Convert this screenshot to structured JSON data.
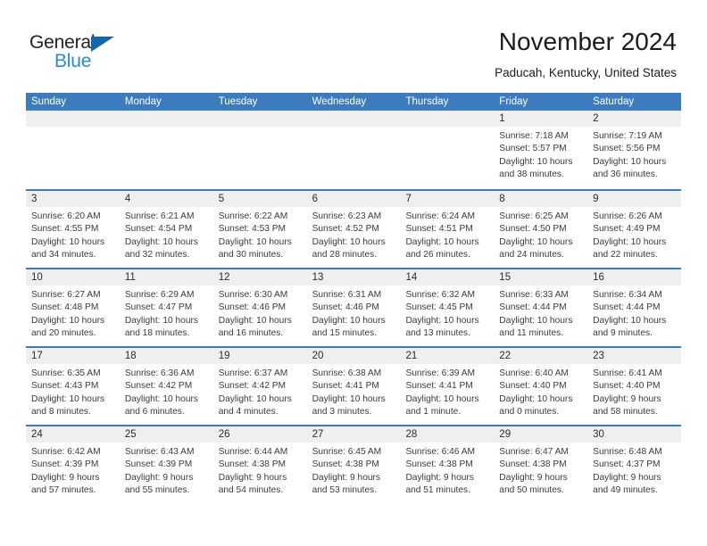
{
  "brand": {
    "name_part1": "General",
    "name_part2": "Blue",
    "triangle_color": "#1266ad",
    "blue_color": "#2a8ad4"
  },
  "header": {
    "title": "November 2024",
    "subtitle": "Paducah, Kentucky, United States",
    "accent_color": "#3c7cbe",
    "band_color": "#efefef"
  },
  "weekdays": [
    "Sunday",
    "Monday",
    "Tuesday",
    "Wednesday",
    "Thursday",
    "Friday",
    "Saturday"
  ],
  "labels": {
    "sunrise": "Sunrise:",
    "sunset": "Sunset:",
    "daylight": "Daylight:"
  },
  "weeks": [
    [
      {
        "day": "",
        "empty": true
      },
      {
        "day": "",
        "empty": true
      },
      {
        "day": "",
        "empty": true
      },
      {
        "day": "",
        "empty": true
      },
      {
        "day": "",
        "empty": true
      },
      {
        "day": "1",
        "sunrise": "Sunrise: 7:18 AM",
        "sunset": "Sunset: 5:57 PM",
        "daylight_line1": "Daylight: 10 hours",
        "daylight_line2": "and 38 minutes."
      },
      {
        "day": "2",
        "sunrise": "Sunrise: 7:19 AM",
        "sunset": "Sunset: 5:56 PM",
        "daylight_line1": "Daylight: 10 hours",
        "daylight_line2": "and 36 minutes."
      }
    ],
    [
      {
        "day": "3",
        "sunrise": "Sunrise: 6:20 AM",
        "sunset": "Sunset: 4:55 PM",
        "daylight_line1": "Daylight: 10 hours",
        "daylight_line2": "and 34 minutes."
      },
      {
        "day": "4",
        "sunrise": "Sunrise: 6:21 AM",
        "sunset": "Sunset: 4:54 PM",
        "daylight_line1": "Daylight: 10 hours",
        "daylight_line2": "and 32 minutes."
      },
      {
        "day": "5",
        "sunrise": "Sunrise: 6:22 AM",
        "sunset": "Sunset: 4:53 PM",
        "daylight_line1": "Daylight: 10 hours",
        "daylight_line2": "and 30 minutes."
      },
      {
        "day": "6",
        "sunrise": "Sunrise: 6:23 AM",
        "sunset": "Sunset: 4:52 PM",
        "daylight_line1": "Daylight: 10 hours",
        "daylight_line2": "and 28 minutes."
      },
      {
        "day": "7",
        "sunrise": "Sunrise: 6:24 AM",
        "sunset": "Sunset: 4:51 PM",
        "daylight_line1": "Daylight: 10 hours",
        "daylight_line2": "and 26 minutes."
      },
      {
        "day": "8",
        "sunrise": "Sunrise: 6:25 AM",
        "sunset": "Sunset: 4:50 PM",
        "daylight_line1": "Daylight: 10 hours",
        "daylight_line2": "and 24 minutes."
      },
      {
        "day": "9",
        "sunrise": "Sunrise: 6:26 AM",
        "sunset": "Sunset: 4:49 PM",
        "daylight_line1": "Daylight: 10 hours",
        "daylight_line2": "and 22 minutes."
      }
    ],
    [
      {
        "day": "10",
        "sunrise": "Sunrise: 6:27 AM",
        "sunset": "Sunset: 4:48 PM",
        "daylight_line1": "Daylight: 10 hours",
        "daylight_line2": "and 20 minutes."
      },
      {
        "day": "11",
        "sunrise": "Sunrise: 6:29 AM",
        "sunset": "Sunset: 4:47 PM",
        "daylight_line1": "Daylight: 10 hours",
        "daylight_line2": "and 18 minutes."
      },
      {
        "day": "12",
        "sunrise": "Sunrise: 6:30 AM",
        "sunset": "Sunset: 4:46 PM",
        "daylight_line1": "Daylight: 10 hours",
        "daylight_line2": "and 16 minutes."
      },
      {
        "day": "13",
        "sunrise": "Sunrise: 6:31 AM",
        "sunset": "Sunset: 4:46 PM",
        "daylight_line1": "Daylight: 10 hours",
        "daylight_line2": "and 15 minutes."
      },
      {
        "day": "14",
        "sunrise": "Sunrise: 6:32 AM",
        "sunset": "Sunset: 4:45 PM",
        "daylight_line1": "Daylight: 10 hours",
        "daylight_line2": "and 13 minutes."
      },
      {
        "day": "15",
        "sunrise": "Sunrise: 6:33 AM",
        "sunset": "Sunset: 4:44 PM",
        "daylight_line1": "Daylight: 10 hours",
        "daylight_line2": "and 11 minutes."
      },
      {
        "day": "16",
        "sunrise": "Sunrise: 6:34 AM",
        "sunset": "Sunset: 4:44 PM",
        "daylight_line1": "Daylight: 10 hours",
        "daylight_line2": "and 9 minutes."
      }
    ],
    [
      {
        "day": "17",
        "sunrise": "Sunrise: 6:35 AM",
        "sunset": "Sunset: 4:43 PM",
        "daylight_line1": "Daylight: 10 hours",
        "daylight_line2": "and 8 minutes."
      },
      {
        "day": "18",
        "sunrise": "Sunrise: 6:36 AM",
        "sunset": "Sunset: 4:42 PM",
        "daylight_line1": "Daylight: 10 hours",
        "daylight_line2": "and 6 minutes."
      },
      {
        "day": "19",
        "sunrise": "Sunrise: 6:37 AM",
        "sunset": "Sunset: 4:42 PM",
        "daylight_line1": "Daylight: 10 hours",
        "daylight_line2": "and 4 minutes."
      },
      {
        "day": "20",
        "sunrise": "Sunrise: 6:38 AM",
        "sunset": "Sunset: 4:41 PM",
        "daylight_line1": "Daylight: 10 hours",
        "daylight_line2": "and 3 minutes."
      },
      {
        "day": "21",
        "sunrise": "Sunrise: 6:39 AM",
        "sunset": "Sunset: 4:41 PM",
        "daylight_line1": "Daylight: 10 hours",
        "daylight_line2": "and 1 minute."
      },
      {
        "day": "22",
        "sunrise": "Sunrise: 6:40 AM",
        "sunset": "Sunset: 4:40 PM",
        "daylight_line1": "Daylight: 10 hours",
        "daylight_line2": "and 0 minutes."
      },
      {
        "day": "23",
        "sunrise": "Sunrise: 6:41 AM",
        "sunset": "Sunset: 4:40 PM",
        "daylight_line1": "Daylight: 9 hours",
        "daylight_line2": "and 58 minutes."
      }
    ],
    [
      {
        "day": "24",
        "sunrise": "Sunrise: 6:42 AM",
        "sunset": "Sunset: 4:39 PM",
        "daylight_line1": "Daylight: 9 hours",
        "daylight_line2": "and 57 minutes."
      },
      {
        "day": "25",
        "sunrise": "Sunrise: 6:43 AM",
        "sunset": "Sunset: 4:39 PM",
        "daylight_line1": "Daylight: 9 hours",
        "daylight_line2": "and 55 minutes."
      },
      {
        "day": "26",
        "sunrise": "Sunrise: 6:44 AM",
        "sunset": "Sunset: 4:38 PM",
        "daylight_line1": "Daylight: 9 hours",
        "daylight_line2": "and 54 minutes."
      },
      {
        "day": "27",
        "sunrise": "Sunrise: 6:45 AM",
        "sunset": "Sunset: 4:38 PM",
        "daylight_line1": "Daylight: 9 hours",
        "daylight_line2": "and 53 minutes."
      },
      {
        "day": "28",
        "sunrise": "Sunrise: 6:46 AM",
        "sunset": "Sunset: 4:38 PM",
        "daylight_line1": "Daylight: 9 hours",
        "daylight_line2": "and 51 minutes."
      },
      {
        "day": "29",
        "sunrise": "Sunrise: 6:47 AM",
        "sunset": "Sunset: 4:38 PM",
        "daylight_line1": "Daylight: 9 hours",
        "daylight_line2": "and 50 minutes."
      },
      {
        "day": "30",
        "sunrise": "Sunrise: 6:48 AM",
        "sunset": "Sunset: 4:37 PM",
        "daylight_line1": "Daylight: 9 hours",
        "daylight_line2": "and 49 minutes."
      }
    ]
  ]
}
